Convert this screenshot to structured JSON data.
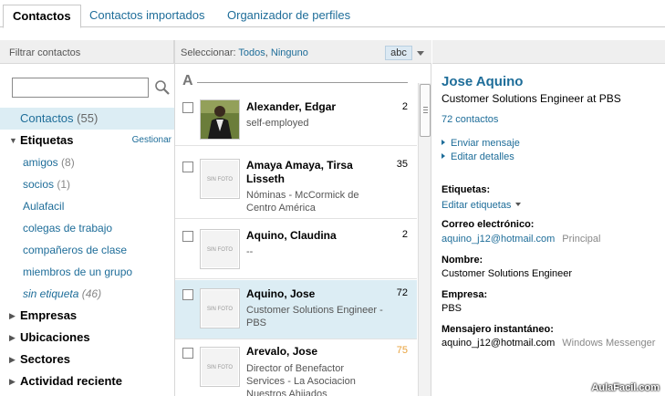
{
  "tabs": [
    {
      "label": "Contactos"
    },
    {
      "label": "Contactos importados"
    },
    {
      "label": "Organizador de perfiles"
    }
  ],
  "filter_header": "Filtrar contactos",
  "search": {
    "value": "",
    "placeholder": ""
  },
  "nav": {
    "all": {
      "label": "Contactos",
      "count": "(55)"
    },
    "labels_header": "Etiquetas",
    "manage": "Gestionar",
    "tags": [
      {
        "label": "amigos",
        "count": "(8)"
      },
      {
        "label": "socios",
        "count": "(1)"
      },
      {
        "label": "Aulafacil",
        "count": ""
      },
      {
        "label": "colegas de trabajo",
        "count": ""
      },
      {
        "label": "compañeros de clase",
        "count": ""
      },
      {
        "label": "miembros de un grupo",
        "count": ""
      },
      {
        "label": "sin etiqueta",
        "count": "(46)"
      }
    ],
    "sections": [
      {
        "label": "Empresas"
      },
      {
        "label": "Ubicaciones"
      },
      {
        "label": "Sectores"
      },
      {
        "label": "Actividad reciente"
      }
    ]
  },
  "list_header": {
    "select_label": "Seleccionar:",
    "all": "Todos",
    "none": "Ninguno",
    "sort": "abc"
  },
  "letter": "A",
  "no_photo": "SIN FOTO",
  "contacts": [
    {
      "name": "Alexander, Edgar",
      "title": "self-employed",
      "count": "2",
      "photo": true,
      "selected": false
    },
    {
      "name": "Amaya Amaya, Tirsa Lisseth",
      "title": "Nóminas - McCormick de Centro América",
      "count": "35",
      "photo": false,
      "selected": false
    },
    {
      "name": "Aquino, Claudina",
      "title": "--",
      "count": "2",
      "photo": false,
      "selected": false
    },
    {
      "name": "Aquino, Jose",
      "title": "Customer Solutions Engineer - PBS",
      "count": "72",
      "photo": false,
      "selected": true
    },
    {
      "name": "Arevalo, Jose",
      "title": "Director of Benefactor Services - La Asociacion Nuestros Ahijados",
      "count": "75",
      "photo": false,
      "selected": false
    }
  ],
  "detail": {
    "name": "Jose Aquino",
    "headline": "Customer Solutions Engineer at PBS",
    "connections": "72 contactos",
    "send_message": "Enviar mensaje",
    "edit_details": "Editar detalles",
    "labels_title": "Etiquetas:",
    "edit_labels": "Editar etiquetas",
    "email_title": "Correo electrónico:",
    "email": "aquino_j12@hotmail.com",
    "email_tag": "Principal",
    "name_title": "Nombre:",
    "name_value": "Customer Solutions Engineer",
    "company_title": "Empresa:",
    "company_value": "PBS",
    "im_title": "Mensajero instantáneo:",
    "im_value": "aquino_j12@hotmail.com",
    "im_tag": "Windows Messenger"
  },
  "watermark": "AulaFacil.com",
  "colors": {
    "link": "#1e6d99",
    "selected_bg": "#dcedf4",
    "header_bg": "#efefef"
  }
}
